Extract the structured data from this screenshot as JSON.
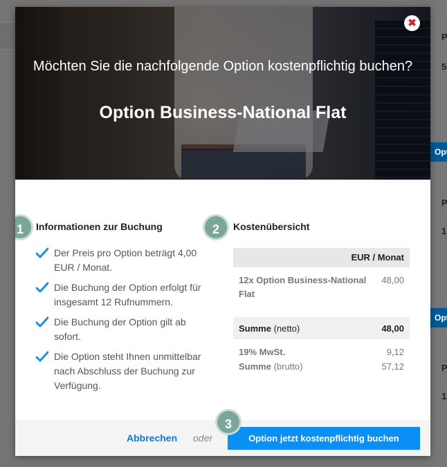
{
  "modal": {
    "close_symbol": "✖",
    "question": "Möchten Sie die nachfolgende Option kostenpflichtig buchen?",
    "option_title": "Option Business-National Flat"
  },
  "steps": [
    "1",
    "2",
    "3"
  ],
  "info": {
    "title": "Informationen zur Buchung",
    "items": [
      "Der Preis pro Option beträgt 4,00 EUR / Monat.",
      "Die Buchung der Option erfolgt für insgesamt 12 Rufnummern.",
      "Die Buchung der Option gilt ab sofort.",
      "Die Option steht Ihnen unmittelbar nach Abschluss der Buchung zur Verfügung."
    ],
    "icon": "checkmark-icon"
  },
  "costs": {
    "title": "Kostenübersicht",
    "header": "EUR / Monat",
    "line_item": {
      "label": "12x Option Business-National Flat",
      "value": "48,00"
    },
    "net": {
      "label_bold": "Summe",
      "label_sub": "(netto)",
      "value": "48,00"
    },
    "vat": {
      "label": "19% MwSt.",
      "value": "9,12"
    },
    "gross": {
      "label_bold": "Summe",
      "label_sub": "(brutto)",
      "value": "57,12"
    }
  },
  "footer": {
    "cancel_label": "Abbrechen",
    "or_label": "oder",
    "confirm_label": "Option jetzt kostenpflichtig buchen"
  },
  "background": {
    "right_texts": [
      "P",
      "5",
      "P",
      "1",
      "P",
      "1"
    ],
    "right_buttons": [
      "Option",
      "Opt"
    ]
  },
  "colors": {
    "accent_blue": "#0a8ff5",
    "link_blue": "#0a7bd6",
    "step_green": "#7ba79a",
    "close_red": "#d9232d"
  }
}
